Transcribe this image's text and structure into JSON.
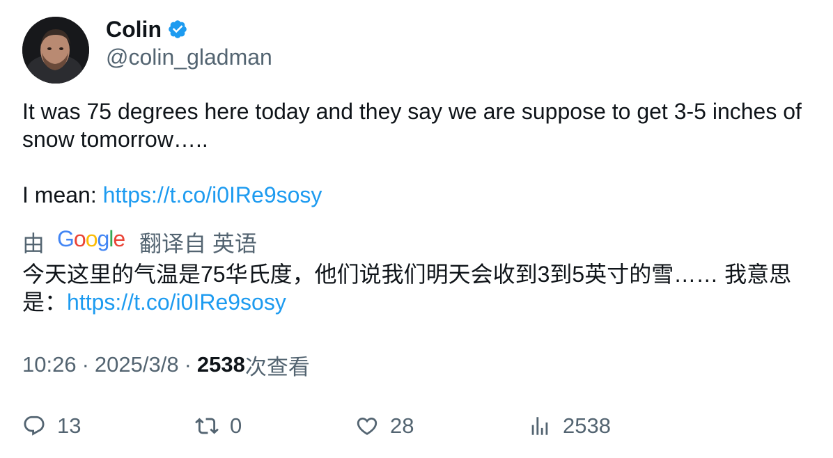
{
  "author": {
    "display_name": "Colin",
    "handle": "@colin_gladman",
    "verified_icon": "verified-badge-icon"
  },
  "tweet": {
    "text_line1": "It was 75 degrees here today and they say we are suppose to get 3-5 inches of snow tomorrow…..",
    "text_prefix2": "I mean: ",
    "link": "https://t.co/i0IRe9sosy"
  },
  "translation": {
    "by_label": "由",
    "provider": "Google",
    "from_label": "翻译自 英语",
    "text": "今天这里的气温是75华氏度，他们说我们明天会收到3到5英寸的雪…… 我意思是：",
    "link": "https://t.co/i0IRe9sosy"
  },
  "meta": {
    "time": "10:26",
    "separator": "·",
    "date": "2025/3/8",
    "views_count": "2538",
    "views_label": "次查看"
  },
  "actions": {
    "replies": "13",
    "retweets": "0",
    "likes": "28",
    "views": "2538"
  },
  "colors": {
    "link": "#1d9bf0",
    "verified": "#1d9bf0",
    "secondary_text": "#536471",
    "primary_text": "#0f1419"
  }
}
